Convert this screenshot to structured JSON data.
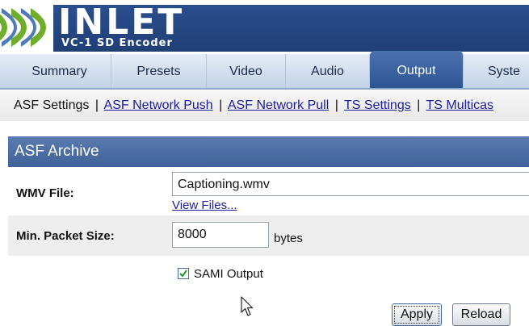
{
  "header": {
    "brand": "INLET",
    "subtitle": "VC-1 SD Encoder",
    "logo_icon": "inlet-logo-icon",
    "colors": {
      "brand_bg": "#2a4f8d",
      "logo_green": "#6fae2c",
      "logo_blue": "#2f63a8"
    }
  },
  "tabs": [
    {
      "label": "Summary",
      "active": false
    },
    {
      "label": "Presets",
      "active": false
    },
    {
      "label": "Video",
      "active": false
    },
    {
      "label": "Audio",
      "active": false
    },
    {
      "label": "Output",
      "active": true
    },
    {
      "label": "Syste",
      "active": false
    }
  ],
  "subnav": {
    "current": "ASF Settings",
    "separator": "|",
    "links": [
      "ASF Network Push",
      "ASF Network Pull",
      "TS Settings",
      "TS Multicas"
    ]
  },
  "section": {
    "title": "ASF Archive",
    "wmv_file": {
      "label": "WMV File:",
      "value": "Captioning.wmv",
      "view_link": "View Files..."
    },
    "packet_size": {
      "label": "Min. Packet Size:",
      "value": "8000",
      "unit": "bytes"
    },
    "sami": {
      "label": "SAMI Output",
      "checked": true
    }
  },
  "buttons": {
    "apply": "Apply",
    "reload": "Reload"
  },
  "icons": {
    "checkmark": "checkmark-icon",
    "cursor": "mouse-cursor-icon"
  }
}
